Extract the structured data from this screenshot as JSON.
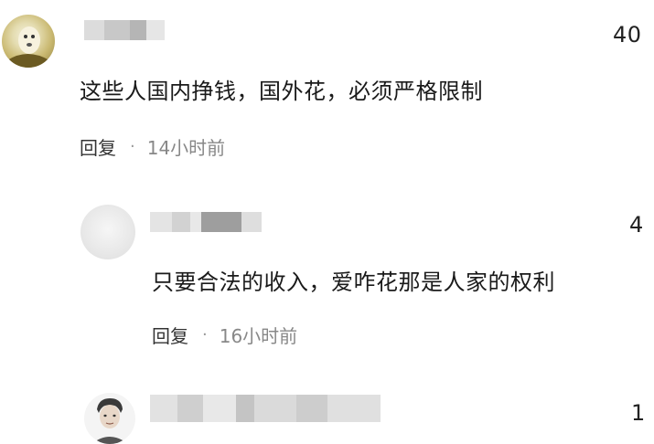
{
  "comments": [
    {
      "like_count": "40",
      "text": "这些人国内挣钱，国外花，必须严格限制",
      "reply_label": "回复",
      "separator": "·",
      "time": "14小时前"
    },
    {
      "like_count": "4",
      "text": "只要合法的收入，爱咋花那是人家的权利",
      "reply_label": "回复",
      "separator": "·",
      "time": "16小时前"
    },
    {
      "like_count": "1"
    }
  ],
  "colors": {
    "text": "#1a1a1a",
    "meta": "#888888",
    "background": "#ffffff"
  },
  "icons": {
    "avatar_1": "avatar-dog-photo",
    "avatar_2": "avatar-gray-blur",
    "avatar_3": "avatar-man-portrait"
  }
}
